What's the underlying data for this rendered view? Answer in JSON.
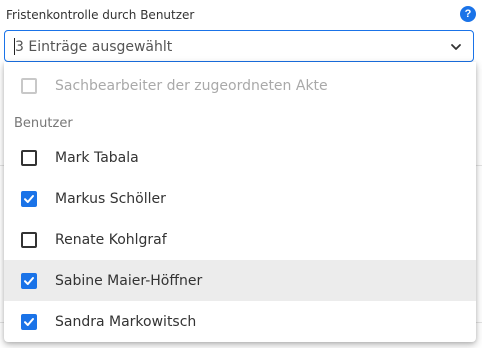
{
  "field": {
    "label": "Fristenkontrolle durch Benutzer",
    "help_icon": "question-circle-icon",
    "help_glyph": "?",
    "selected_text": "3 Einträge ausgewählt",
    "chevron_icon": "chevron-down-icon"
  },
  "dropdown": {
    "top_option": {
      "label": "Sachbearbeiter der zugeordneten Akte",
      "checked": false,
      "disabled": true
    },
    "group_label": "Benutzer",
    "options": [
      {
        "label": "Mark Tabala",
        "checked": false
      },
      {
        "label": "Markus Schöller",
        "checked": true
      },
      {
        "label": "Renate Kohlgraf",
        "checked": false
      },
      {
        "label": "Sabine Maier-Höffner",
        "checked": true
      },
      {
        "label": "Sandra Markowitsch",
        "checked": true
      }
    ]
  },
  "colors": {
    "accent": "#1a73e8",
    "highlight": "#ececec"
  }
}
